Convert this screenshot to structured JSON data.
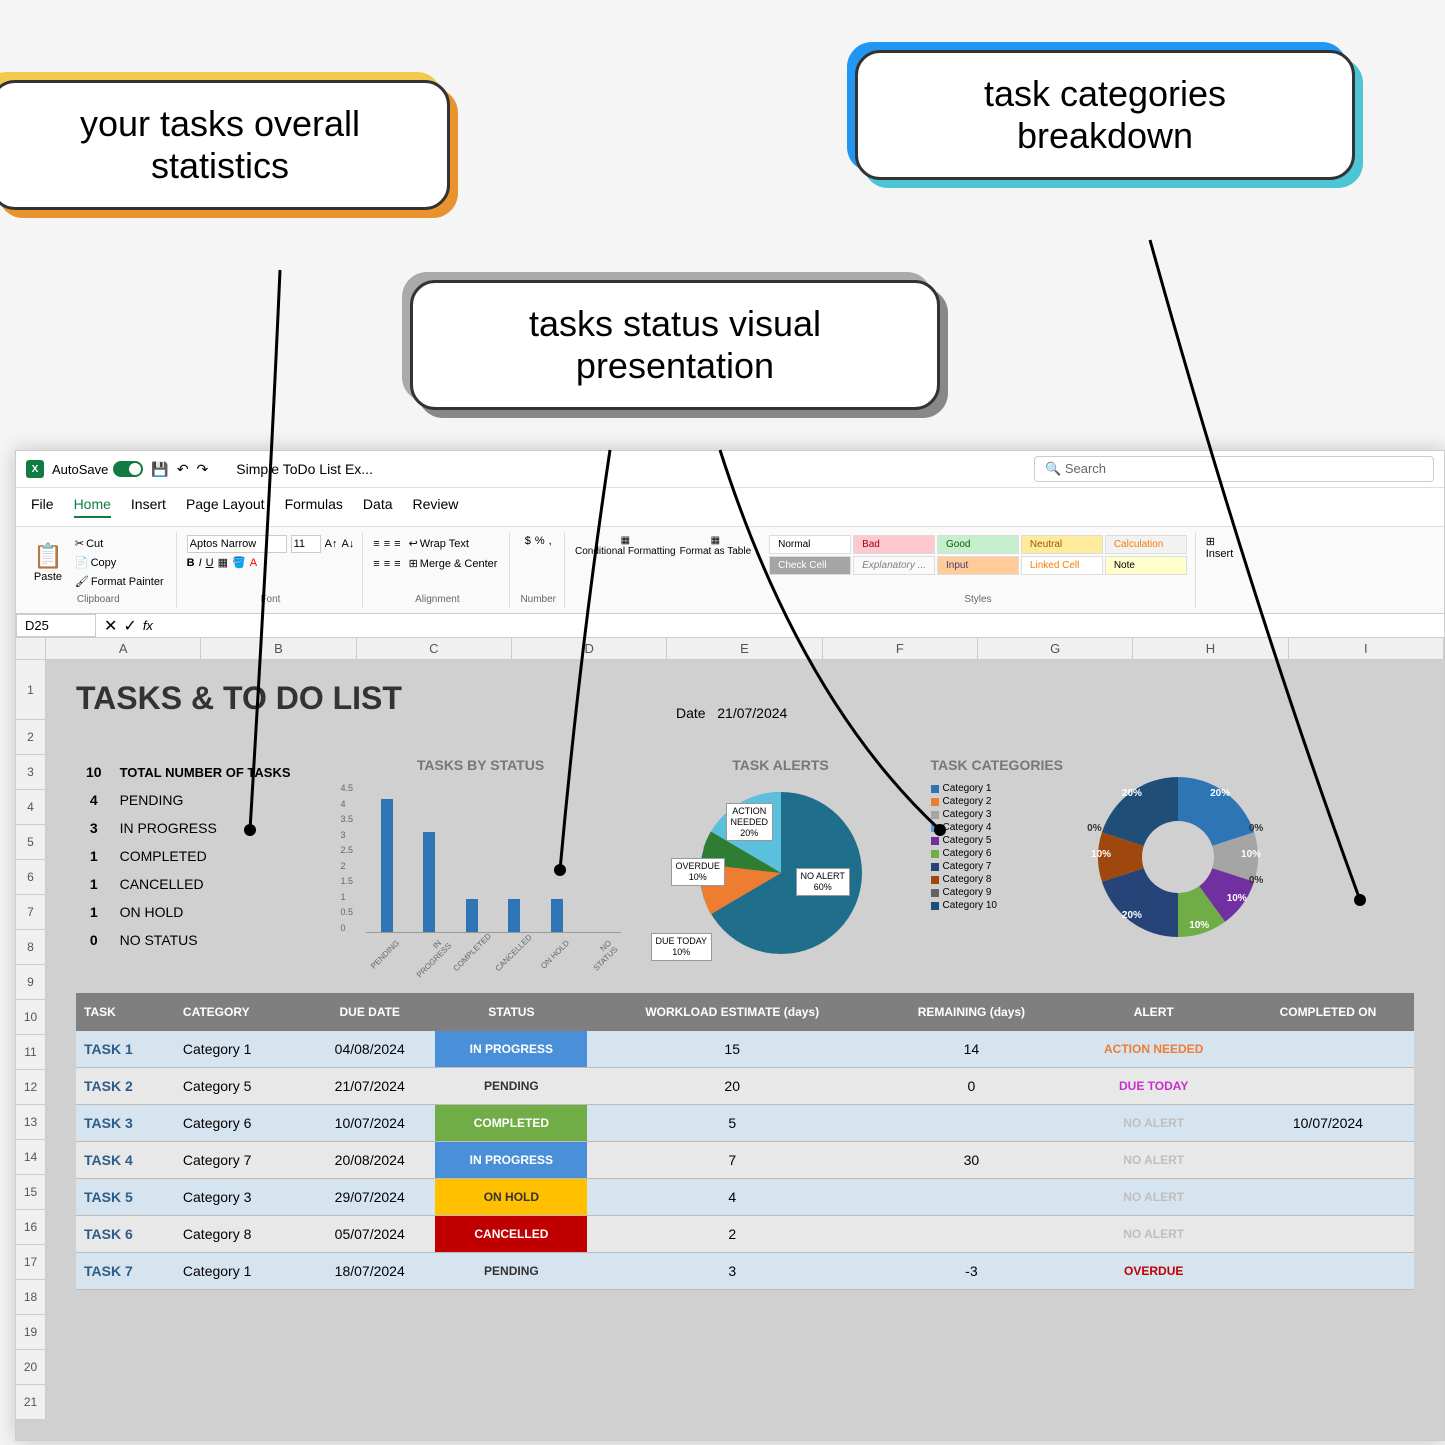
{
  "callouts": {
    "orange": "your tasks overall statistics",
    "gray": "tasks status visual presentation",
    "blue": "task categories breakdown"
  },
  "titlebar": {
    "autosave": "AutoSave",
    "filename": "Simple ToDo List Ex...",
    "search": "Search"
  },
  "tabs": [
    "File",
    "Home",
    "Insert",
    "Page Layout",
    "Formulas",
    "Data",
    "Review"
  ],
  "ribbon": {
    "clipboard": {
      "paste": "Paste",
      "cut": "Cut",
      "copy": "Copy",
      "painter": "Format Painter",
      "label": "Clipboard"
    },
    "font": {
      "name": "Aptos Narrow",
      "size": "11",
      "label": "Font"
    },
    "alignment": {
      "wrap": "Wrap Text",
      "merge": "Merge & Center",
      "label": "Alignment"
    },
    "number": {
      "label": "Number"
    },
    "styles_btns": {
      "cond": "Conditional Formatting",
      "format_table": "Format as Table"
    },
    "cell_styles": {
      "normal": "Normal",
      "bad": "Bad",
      "good": "Good",
      "neutral": "Neutral",
      "calc": "Calculation",
      "check": "Check Cell",
      "explan": "Explanatory ...",
      "input": "Input",
      "linked": "Linked Cell",
      "note": "Note"
    },
    "styles_label": "Styles",
    "insert": "Insert"
  },
  "namebox": "D25",
  "columns": [
    "A",
    "B",
    "C",
    "D",
    "E",
    "F",
    "G",
    "H",
    "I"
  ],
  "rows": [
    "1",
    "2",
    "3",
    "4",
    "5",
    "6",
    "7",
    "8",
    "9",
    "10",
    "11",
    "12",
    "13",
    "14",
    "15",
    "16",
    "17",
    "18",
    "19",
    "20",
    "21"
  ],
  "sheet": {
    "title": "TASKS & TO DO LIST",
    "date_label": "Date",
    "date_value": "21/07/2024"
  },
  "stats": {
    "total_label": "TOTAL NUMBER OF TASKS",
    "total": "10",
    "items": [
      {
        "n": "4",
        "label": "PENDING"
      },
      {
        "n": "3",
        "label": "IN PROGRESS"
      },
      {
        "n": "1",
        "label": "COMPLETED"
      },
      {
        "n": "1",
        "label": "CANCELLED"
      },
      {
        "n": "1",
        "label": "ON HOLD"
      },
      {
        "n": "0",
        "label": "NO STATUS"
      }
    ]
  },
  "chart_data": [
    {
      "type": "bar",
      "title": "TASKS BY STATUS",
      "categories": [
        "PENDING",
        "IN PROGRESS",
        "COMPLETED",
        "CANCELLED",
        "ON HOLD",
        "NO STATUS"
      ],
      "values": [
        4,
        3,
        1,
        1,
        1,
        0
      ],
      "ylim": [
        0,
        4.5
      ],
      "y_ticks": [
        0,
        0.5,
        1,
        1.5,
        2,
        2.5,
        3,
        3.5,
        4,
        4.5
      ]
    },
    {
      "type": "pie",
      "title": "TASK ALERTS",
      "series": [
        {
          "name": "NO ALERT",
          "value": 60
        },
        {
          "name": "ACTION NEEDED",
          "value": 20
        },
        {
          "name": "OVERDUE",
          "value": 10
        },
        {
          "name": "DUE TODAY",
          "value": 10
        }
      ]
    },
    {
      "type": "donut",
      "title": "TASK CATEGORIES",
      "series": [
        {
          "name": "Category 1",
          "value": 20,
          "color": "#2e75b6"
        },
        {
          "name": "Category 2",
          "value": 0,
          "color": "#ed7d31"
        },
        {
          "name": "Category 3",
          "value": 10,
          "color": "#a5a5a5"
        },
        {
          "name": "Category 4",
          "value": 0,
          "color": "#5b9bd5"
        },
        {
          "name": "Category 5",
          "value": 10,
          "color": "#7030a0"
        },
        {
          "name": "Category 6",
          "value": 10,
          "color": "#70ad47"
        },
        {
          "name": "Category 7",
          "value": 20,
          "color": "#264478"
        },
        {
          "name": "Category 8",
          "value": 10,
          "color": "#9e480e"
        },
        {
          "name": "Category 9",
          "value": 0,
          "color": "#636363"
        },
        {
          "name": "Category 10",
          "value": 20,
          "color": "#1f4e79"
        }
      ]
    }
  ],
  "legend_title": "TASK CATEGORIES",
  "table": {
    "headers": [
      "TASK",
      "CATEGORY",
      "DUE DATE",
      "STATUS",
      "WORKLOAD ESTIMATE (days)",
      "REMAINING (days)",
      "ALERT",
      "COMPLETED ON"
    ],
    "rows": [
      {
        "task": "TASK 1",
        "cat": "Category 1",
        "due": "04/08/2024",
        "status": "IN PROGRESS",
        "st_class": "st-progress",
        "work": "15",
        "rem": "14",
        "alert": "ACTION NEEDED",
        "al_class": "al-action",
        "done": "",
        "row_class": "blue-row"
      },
      {
        "task": "TASK 2",
        "cat": "Category 5",
        "due": "21/07/2024",
        "status": "PENDING",
        "st_class": "st-pending",
        "work": "20",
        "rem": "0",
        "alert": "DUE TODAY",
        "al_class": "al-today",
        "done": "",
        "row_class": "gray-row"
      },
      {
        "task": "TASK 3",
        "cat": "Category 6",
        "due": "10/07/2024",
        "status": "COMPLETED",
        "st_class": "st-completed",
        "work": "5",
        "rem": "",
        "alert": "NO ALERT",
        "al_class": "al-none",
        "done": "10/07/2024",
        "row_class": "blue-row"
      },
      {
        "task": "TASK 4",
        "cat": "Category 7",
        "due": "20/08/2024",
        "status": "IN PROGRESS",
        "st_class": "st-progress",
        "work": "7",
        "rem": "30",
        "alert": "NO ALERT",
        "al_class": "al-none",
        "done": "",
        "row_class": "gray-row"
      },
      {
        "task": "TASK 5",
        "cat": "Category 3",
        "due": "29/07/2024",
        "status": "ON HOLD",
        "st_class": "st-hold",
        "work": "4",
        "rem": "",
        "alert": "NO ALERT",
        "al_class": "al-none",
        "done": "",
        "row_class": "blue-row"
      },
      {
        "task": "TASK 6",
        "cat": "Category 8",
        "due": "05/07/2024",
        "status": "CANCELLED",
        "st_class": "st-cancelled",
        "work": "2",
        "rem": "",
        "alert": "NO ALERT",
        "al_class": "al-none",
        "done": "",
        "row_class": "gray-row"
      },
      {
        "task": "TASK 7",
        "cat": "Category 1",
        "due": "18/07/2024",
        "status": "PENDING",
        "st_class": "st-pending",
        "work": "3",
        "rem": "-3",
        "alert": "OVERDUE",
        "al_class": "al-overdue",
        "done": "",
        "row_class": "blue-row"
      }
    ]
  }
}
